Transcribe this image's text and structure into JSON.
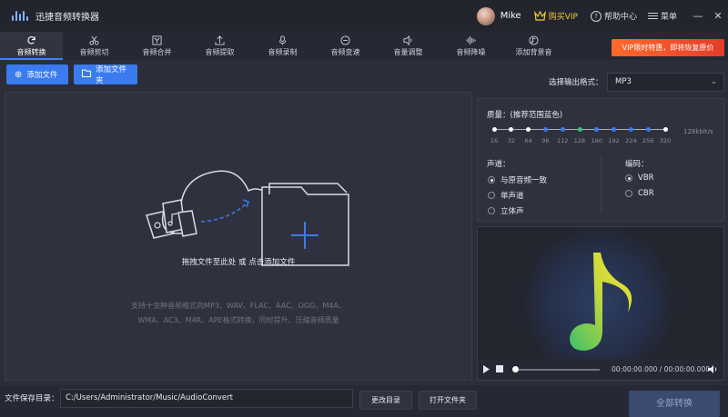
{
  "titlebar": {
    "app_title": "迅捷音频转换器",
    "user_name": "Mike",
    "vip_label": "购买VIP",
    "help_label": "帮助中心",
    "menu_label": "菜单",
    "minimize_glyph": "—",
    "close_glyph": "✕"
  },
  "tabs": [
    {
      "label": "音频转换",
      "icon": "refresh-icon",
      "active": true
    },
    {
      "label": "音频剪切",
      "icon": "scissors-icon",
      "active": false
    },
    {
      "label": "音频合并",
      "icon": "merge-icon",
      "active": false
    },
    {
      "label": "音频提取",
      "icon": "extract-icon",
      "active": false
    },
    {
      "label": "音频录制",
      "icon": "microphone-icon",
      "active": false
    },
    {
      "label": "音频变速",
      "icon": "speed-icon",
      "active": false
    },
    {
      "label": "音量调整",
      "icon": "volume-icon",
      "active": false
    },
    {
      "label": "音频降噪",
      "icon": "waveform-icon",
      "active": false
    },
    {
      "label": "添加背景音",
      "icon": "music-icon",
      "active": false
    }
  ],
  "promo": {
    "label": "VIP限时特惠，即将恢复原价"
  },
  "toolbar": {
    "add_file_label": "添加文件",
    "add_folder_label": "添加文件夹",
    "format_label": "选择输出格式：",
    "format_value": "MP3"
  },
  "drop": {
    "main_text": "拖拽文件至此处 或 点击添加文件",
    "hint_line1": "支持十余种音频格式向MP3、WAV、FLAC、AAC、OGG、M4A、",
    "hint_line2": "WMA、AC3、M4R、APE格式转换，同时提升、压缩音频质量"
  },
  "quality": {
    "label": "质量：(推荐范围蓝色)",
    "ticks": [
      "16",
      "32",
      "64",
      "96",
      "112",
      "128",
      "160",
      "192",
      "224",
      "256",
      "320"
    ],
    "selected": "128",
    "current_rate": "128kbit/s"
  },
  "channel": {
    "label": "声道：",
    "options": [
      "与原音频一致",
      "单声道",
      "立体声"
    ],
    "selected": "与原音频一致"
  },
  "encoding": {
    "label": "编码：",
    "options": [
      "VBR",
      "CBR"
    ],
    "selected": "VBR"
  },
  "player": {
    "time": "00:00:00.000 / 00:00:00.000",
    "progress": 0
  },
  "status": {
    "save_dir_label": "文件保存目录：",
    "save_dir_value": "C:/Users/Administrator/Music/AudioConvert",
    "change_dir_label": "更改目录",
    "open_folder_label": "打开文件夹",
    "convert_all_label": "全部转换"
  },
  "colors": {
    "accent": "#3a7bef",
    "vip": "#f3c93d",
    "promo": "#ff6a2b",
    "slider_selected": "#3fc07c"
  }
}
